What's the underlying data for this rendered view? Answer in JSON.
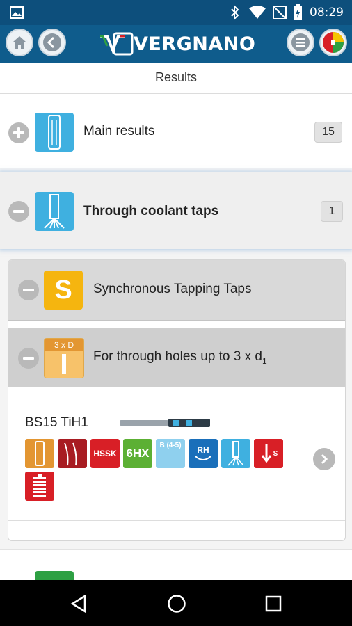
{
  "status": {
    "time": "08:29"
  },
  "app": {
    "brand": "VERGNANO"
  },
  "page": {
    "title": "Results"
  },
  "sections": [
    {
      "label": "Main results",
      "count": "15",
      "state": "collapsed"
    },
    {
      "label": "Through coolant taps",
      "count": "1",
      "state": "expanded"
    }
  ],
  "sub": {
    "label": "Synchronous Tapping Taps",
    "tile_letter": "S"
  },
  "subsub": {
    "label": "For through holes up to 3 x d",
    "subscript": "1",
    "tile_label": "3 x D"
  },
  "product": {
    "name": "BS15 TiH1",
    "badges": [
      "HSSK",
      "6HX",
      "B (4-5)",
      "RH",
      "S"
    ]
  },
  "colors": {
    "primary": "#0f5c8c",
    "orange": "#e39632",
    "yellow": "#f5b50f",
    "red": "#d81f26",
    "green": "#5cb034",
    "cyan": "#3fb0e0",
    "blue": "#1a6fba"
  }
}
